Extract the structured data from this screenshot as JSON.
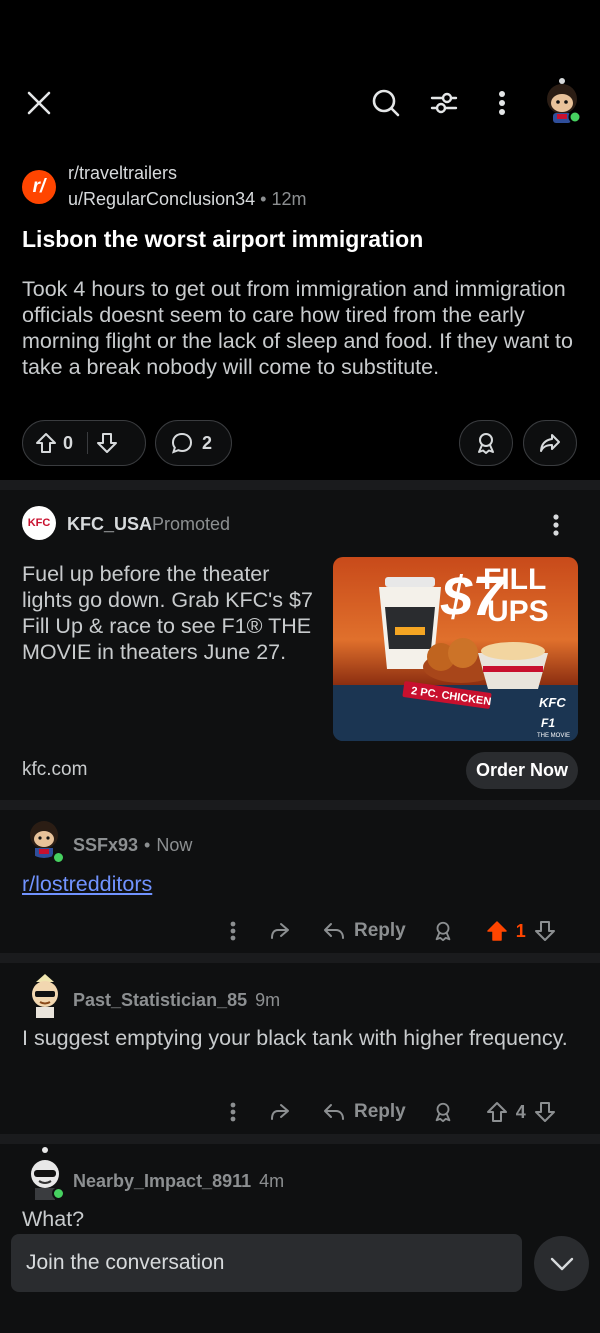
{
  "header": {
    "icons": [
      "close-icon",
      "search-icon",
      "sort-filter-icon",
      "more-vertical-icon",
      "user-avatar"
    ]
  },
  "post": {
    "subreddit": "r/traveltrailers",
    "author": "u/RegularConclusion34",
    "time": "12m",
    "separator": "•",
    "title": "Lisbon the worst airport immigration",
    "body": "Took 4 hours to get out from immigration and immigration officials doesnt seem to care how tired from the early morning flight or the lack of sleep and food. If they want to take a break nobody will come to substitute.",
    "votes": "0",
    "comments": "2"
  },
  "ad": {
    "advertiser": "KFC_USA",
    "promoted_label": "Promoted",
    "text": "Fuel up before the theater lights go down. Grab KFC's $7 Fill Up & race to see F1® THE MOVIE in theaters June 27.",
    "domain": "kfc.com",
    "cta": "Order Now",
    "image": {
      "price": "$7",
      "headline_1": "FILL",
      "headline_2": "UPS",
      "tag": "2 PC. CHICKEN",
      "brand": "KFC",
      "f1": "F1",
      "movie": "THE MOVIE"
    },
    "avatar_text": "KFC"
  },
  "comments": [
    {
      "user": "SSFx93",
      "time": "Now",
      "text": "r/lostredditors",
      "score": "1",
      "reply_label": "Reply",
      "upvoted": true
    },
    {
      "user": "Past_Statistician_85",
      "time": "9m",
      "text": "I suggest emptying your black tank with higher frequency.",
      "score": "4",
      "reply_label": "Reply",
      "upvoted": false
    },
    {
      "user": "Nearby_Impact_8911",
      "time": "4m",
      "text": "What?"
    }
  ],
  "composer": {
    "placeholder": "Join the conversation"
  },
  "colors": {
    "accent_orange": "#ff4500",
    "link_blue": "#7193ff",
    "online_green": "#46d160",
    "background": "#000000",
    "card": "#0f1011"
  }
}
